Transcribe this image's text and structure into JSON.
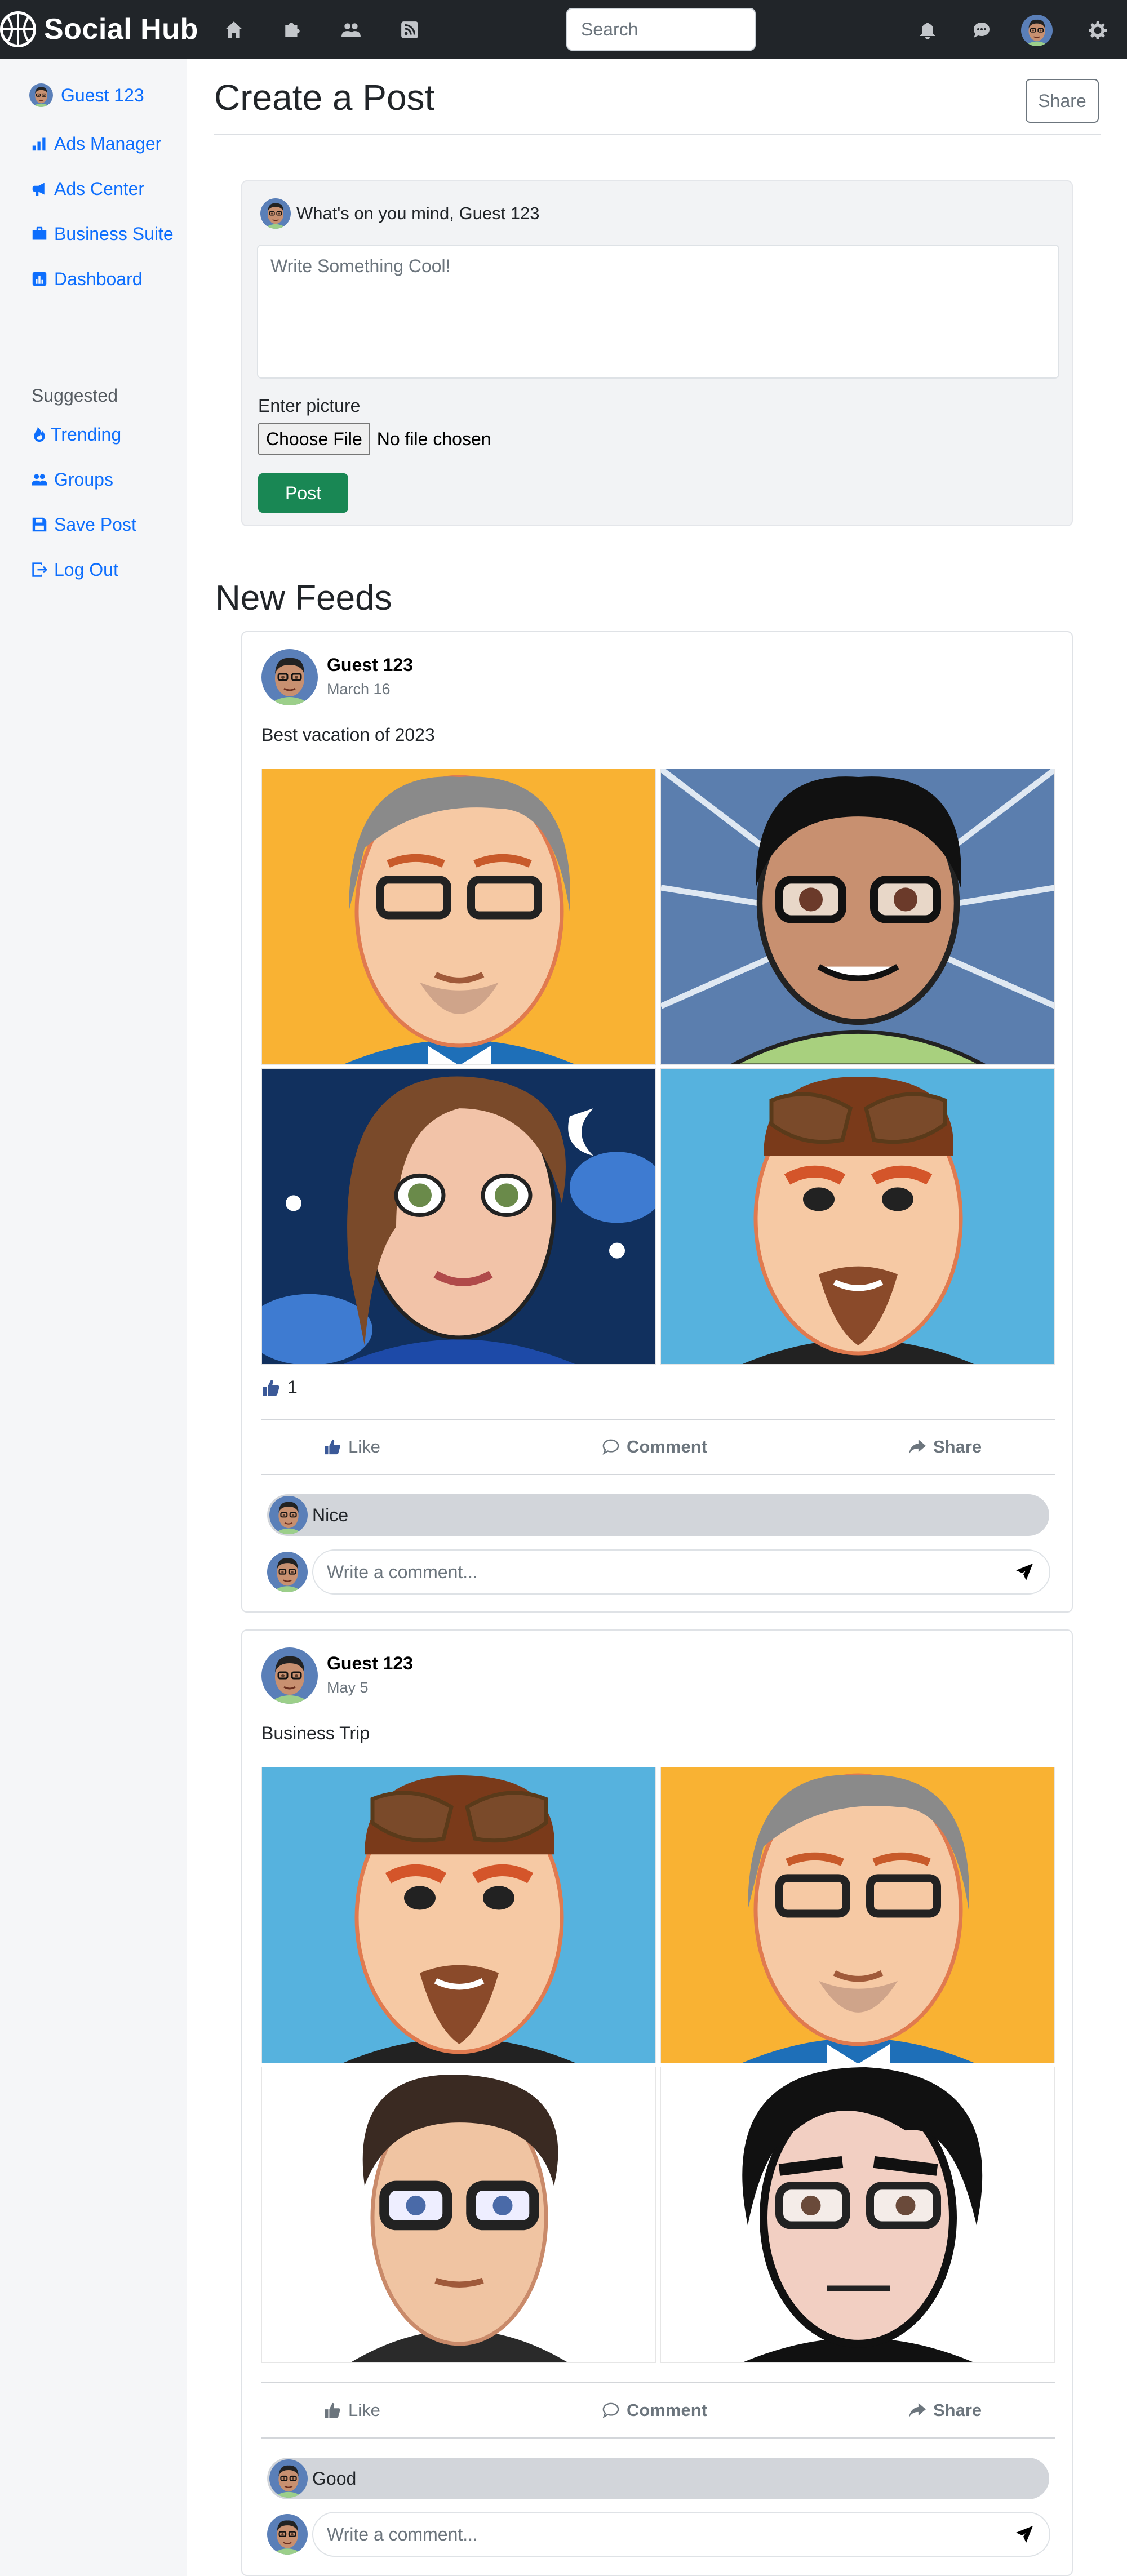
{
  "navbar": {
    "brand": "Social Hub",
    "search_placeholder": "Search",
    "icons": [
      "home-icon",
      "puzzle-icon",
      "people-icon",
      "rss-icon"
    ],
    "right_icons": [
      "bell-icon",
      "chat-icon",
      "avatar",
      "gear-icon"
    ]
  },
  "sidebar": {
    "user": "Guest 123",
    "items": [
      {
        "label": "Ads Manager",
        "icon": "bar-chart-icon"
      },
      {
        "label": "Ads Center",
        "icon": "megaphone-icon"
      },
      {
        "label": "Business Suite",
        "icon": "briefcase-icon"
      },
      {
        "label": "Dashboard",
        "icon": "dashboard-icon"
      }
    ],
    "suggested_heading": "Suggested",
    "suggested": [
      {
        "label": "Trending",
        "icon": "fire-icon"
      },
      {
        "label": "Groups",
        "icon": "people-icon"
      },
      {
        "label": "Save Post",
        "icon": "save-icon"
      },
      {
        "label": "Log Out",
        "icon": "logout-icon"
      }
    ]
  },
  "main": {
    "title": "Create a Post",
    "share_label": "Share",
    "composer": {
      "heading": "What's on you mind, Guest 123",
      "placeholder": "Write Something Cool!",
      "picture_label": "Enter picture",
      "choose_file": "Choose File",
      "no_file": "No file chosen",
      "post_label": "Post"
    },
    "feeds_title": "New Feeds"
  },
  "posts": [
    {
      "author": "Guest 123",
      "date": "March 16",
      "text": "Best vacation of 2023",
      "likes": "1",
      "like_label": "Like",
      "comment_label": "Comment",
      "share_label": "Share",
      "comment": "Nice",
      "comment_placeholder": "Write a comment..."
    },
    {
      "author": "Guest 123",
      "date": "May 5",
      "text": "Business Trip",
      "like_label": "Like",
      "comment_label": "Comment",
      "share_label": "Share",
      "comment": "Good",
      "comment_placeholder": "Write a comment..."
    }
  ],
  "colors": {
    "navbar": "#212529",
    "sidebar": "#f5f6f8",
    "link": "#0d6efd",
    "post_button": "#198754",
    "comment_bubble": "#d2d5da"
  }
}
